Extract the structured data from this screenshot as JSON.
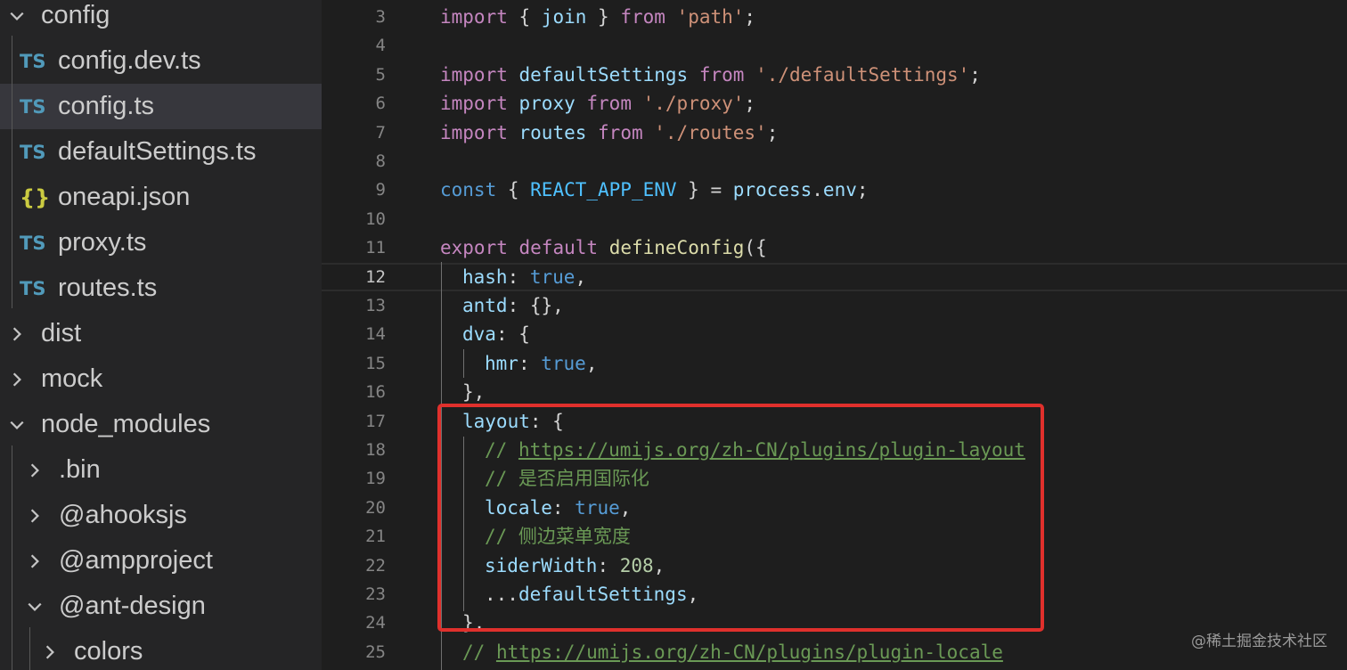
{
  "explorer": {
    "items": [
      {
        "label": "config",
        "type": "folder",
        "expanded": true,
        "depth": 0
      },
      {
        "label": "config.dev.ts",
        "type": "ts",
        "icon_text": "TS",
        "depth": 1
      },
      {
        "label": "config.ts",
        "type": "ts",
        "icon_text": "TS",
        "depth": 1,
        "selected": true
      },
      {
        "label": "defaultSettings.ts",
        "type": "ts",
        "icon_text": "TS",
        "depth": 1
      },
      {
        "label": "oneapi.json",
        "type": "json",
        "icon_text": "{}",
        "depth": 1
      },
      {
        "label": "proxy.ts",
        "type": "ts",
        "icon_text": "TS",
        "depth": 1
      },
      {
        "label": "routes.ts",
        "type": "ts",
        "icon_text": "TS",
        "depth": 1
      },
      {
        "label": "dist",
        "type": "folder",
        "expanded": false,
        "depth": 0
      },
      {
        "label": "mock",
        "type": "folder",
        "expanded": false,
        "depth": 0
      },
      {
        "label": "node_modules",
        "type": "folder",
        "expanded": true,
        "depth": 0
      },
      {
        "label": ".bin",
        "type": "folder",
        "expanded": false,
        "depth": 1
      },
      {
        "label": "@ahooksjs",
        "type": "folder",
        "expanded": false,
        "depth": 1
      },
      {
        "label": "@ampproject",
        "type": "folder",
        "expanded": false,
        "depth": 1
      },
      {
        "label": "@ant-design",
        "type": "folder",
        "expanded": true,
        "depth": 1
      },
      {
        "label": "colors",
        "type": "folder",
        "expanded": false,
        "depth": 2
      }
    ]
  },
  "editor": {
    "active_line": 12,
    "lines": [
      {
        "n": "3",
        "indent": 0,
        "tokens": [
          {
            "t": "import",
            "c": "ctl"
          },
          {
            "t": " { ",
            "c": "p"
          },
          {
            "t": "join",
            "c": "var"
          },
          {
            "t": " } ",
            "c": "p"
          },
          {
            "t": "from",
            "c": "ctl"
          },
          {
            "t": " ",
            "c": "p"
          },
          {
            "t": "'path'",
            "c": "str"
          },
          {
            "t": ";",
            "c": "p"
          }
        ]
      },
      {
        "n": "4",
        "indent": 0,
        "tokens": []
      },
      {
        "n": "5",
        "indent": 0,
        "tokens": [
          {
            "t": "import",
            "c": "ctl"
          },
          {
            "t": " ",
            "c": "p"
          },
          {
            "t": "defaultSettings",
            "c": "var"
          },
          {
            "t": " ",
            "c": "p"
          },
          {
            "t": "from",
            "c": "ctl"
          },
          {
            "t": " ",
            "c": "p"
          },
          {
            "t": "'./defaultSettings'",
            "c": "str"
          },
          {
            "t": ";",
            "c": "p"
          }
        ]
      },
      {
        "n": "6",
        "indent": 0,
        "tokens": [
          {
            "t": "import",
            "c": "ctl"
          },
          {
            "t": " ",
            "c": "p"
          },
          {
            "t": "proxy",
            "c": "var"
          },
          {
            "t": " ",
            "c": "p"
          },
          {
            "t": "from",
            "c": "ctl"
          },
          {
            "t": " ",
            "c": "p"
          },
          {
            "t": "'./proxy'",
            "c": "str"
          },
          {
            "t": ";",
            "c": "p"
          }
        ]
      },
      {
        "n": "7",
        "indent": 0,
        "tokens": [
          {
            "t": "import",
            "c": "ctl"
          },
          {
            "t": " ",
            "c": "p"
          },
          {
            "t": "routes",
            "c": "var"
          },
          {
            "t": " ",
            "c": "p"
          },
          {
            "t": "from",
            "c": "ctl"
          },
          {
            "t": " ",
            "c": "p"
          },
          {
            "t": "'./routes'",
            "c": "str"
          },
          {
            "t": ";",
            "c": "p"
          }
        ]
      },
      {
        "n": "8",
        "indent": 0,
        "tokens": []
      },
      {
        "n": "9",
        "indent": 0,
        "tokens": [
          {
            "t": "const",
            "c": "kw"
          },
          {
            "t": " { ",
            "c": "p"
          },
          {
            "t": "REACT_APP_ENV",
            "c": "const"
          },
          {
            "t": " } = ",
            "c": "p"
          },
          {
            "t": "process",
            "c": "var"
          },
          {
            "t": ".",
            "c": "p"
          },
          {
            "t": "env",
            "c": "var"
          },
          {
            "t": ";",
            "c": "p"
          }
        ]
      },
      {
        "n": "10",
        "indent": 0,
        "tokens": []
      },
      {
        "n": "11",
        "indent": 0,
        "tokens": [
          {
            "t": "export",
            "c": "ctl"
          },
          {
            "t": " ",
            "c": "p"
          },
          {
            "t": "default",
            "c": "ctl"
          },
          {
            "t": " ",
            "c": "p"
          },
          {
            "t": "defineConfig",
            "c": "fn"
          },
          {
            "t": "({",
            "c": "p"
          }
        ]
      },
      {
        "n": "12",
        "indent": 1,
        "tokens": [
          {
            "t": "hash",
            "c": "var"
          },
          {
            "t": ": ",
            "c": "p"
          },
          {
            "t": "true",
            "c": "kw"
          },
          {
            "t": ",",
            "c": "p"
          }
        ]
      },
      {
        "n": "13",
        "indent": 1,
        "tokens": [
          {
            "t": "antd",
            "c": "var"
          },
          {
            "t": ": {},",
            "c": "p"
          }
        ]
      },
      {
        "n": "14",
        "indent": 1,
        "tokens": [
          {
            "t": "dva",
            "c": "var"
          },
          {
            "t": ": {",
            "c": "p"
          }
        ]
      },
      {
        "n": "15",
        "indent": 2,
        "tokens": [
          {
            "t": "hmr",
            "c": "var"
          },
          {
            "t": ": ",
            "c": "p"
          },
          {
            "t": "true",
            "c": "kw"
          },
          {
            "t": ",",
            "c": "p"
          }
        ]
      },
      {
        "n": "16",
        "indent": 1,
        "tokens": [
          {
            "t": "},",
            "c": "p"
          }
        ]
      },
      {
        "n": "17",
        "indent": 1,
        "tokens": [
          {
            "t": "layout",
            "c": "var"
          },
          {
            "t": ": {",
            "c": "p"
          }
        ]
      },
      {
        "n": "18",
        "indent": 2,
        "tokens": [
          {
            "t": "// ",
            "c": "cmt"
          },
          {
            "t": "https://umijs.org/zh-CN/plugins/plugin-layout",
            "c": "url"
          }
        ]
      },
      {
        "n": "19",
        "indent": 2,
        "tokens": [
          {
            "t": "// 是否启用国际化",
            "c": "cmt"
          }
        ]
      },
      {
        "n": "20",
        "indent": 2,
        "tokens": [
          {
            "t": "locale",
            "c": "var"
          },
          {
            "t": ": ",
            "c": "p"
          },
          {
            "t": "true",
            "c": "kw"
          },
          {
            "t": ",",
            "c": "p"
          }
        ]
      },
      {
        "n": "21",
        "indent": 2,
        "tokens": [
          {
            "t": "// 侧边菜单宽度",
            "c": "cmt"
          }
        ]
      },
      {
        "n": "22",
        "indent": 2,
        "tokens": [
          {
            "t": "siderWidth",
            "c": "var"
          },
          {
            "t": ": ",
            "c": "p"
          },
          {
            "t": "208",
            "c": "num"
          },
          {
            "t": ",",
            "c": "p"
          }
        ]
      },
      {
        "n": "23",
        "indent": 2,
        "tokens": [
          {
            "t": "...",
            "c": "p"
          },
          {
            "t": "defaultSettings",
            "c": "var"
          },
          {
            "t": ",",
            "c": "p"
          }
        ]
      },
      {
        "n": "24",
        "indent": 1,
        "tokens": [
          {
            "t": "},",
            "c": "p"
          }
        ]
      },
      {
        "n": "25",
        "indent": 1,
        "tokens": [
          {
            "t": "// ",
            "c": "cmt"
          },
          {
            "t": "https://umijs.org/zh-CN/plugins/plugin-locale",
            "c": "url"
          }
        ]
      }
    ]
  },
  "watermark": "@稀土掘金技术社区",
  "colors": {
    "selection_box": "#e0302c",
    "ts_icon": "#519aba",
    "json_icon": "#cbcb41"
  }
}
